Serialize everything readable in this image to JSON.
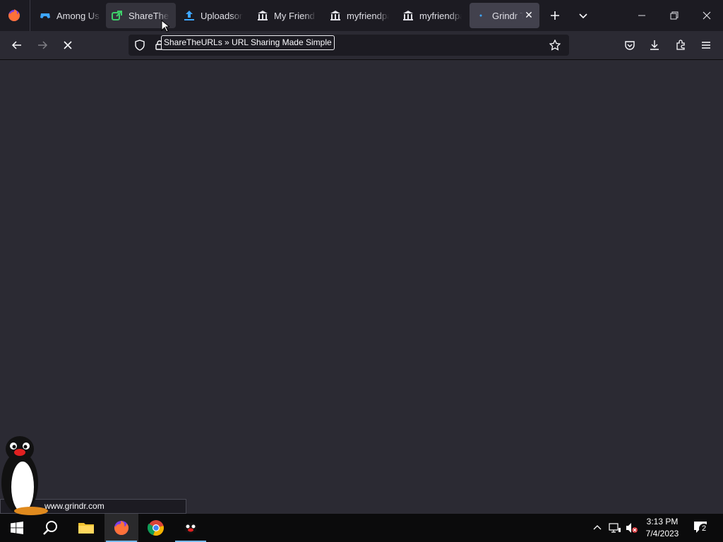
{
  "tabs": [
    {
      "label": "Among Us",
      "icon": "gamepad-icon"
    },
    {
      "label": "ShareTheURLs",
      "icon": "share-icon"
    },
    {
      "label": "Uploadsome",
      "icon": "upload-icon"
    },
    {
      "label": "My Friend P",
      "icon": "bank-icon"
    },
    {
      "label": "myfriendpay",
      "icon": "bank-icon"
    },
    {
      "label": "myfriendpay",
      "icon": "bank-icon"
    },
    {
      "label": "Grindr T",
      "icon": "loading-icon"
    }
  ],
  "tooltip": "ShareTheURLs » URL Sharing Made Simple",
  "status_url": "www.grindr.com",
  "clock": {
    "time": "3:13 PM",
    "date": "7/4/2023"
  },
  "notification_count": "2",
  "colors": {
    "accent": "#76b9ed",
    "chrome_bg": "#1c1b22",
    "toolbar_bg": "#2b2a33",
    "active_tab": "#42414d"
  }
}
